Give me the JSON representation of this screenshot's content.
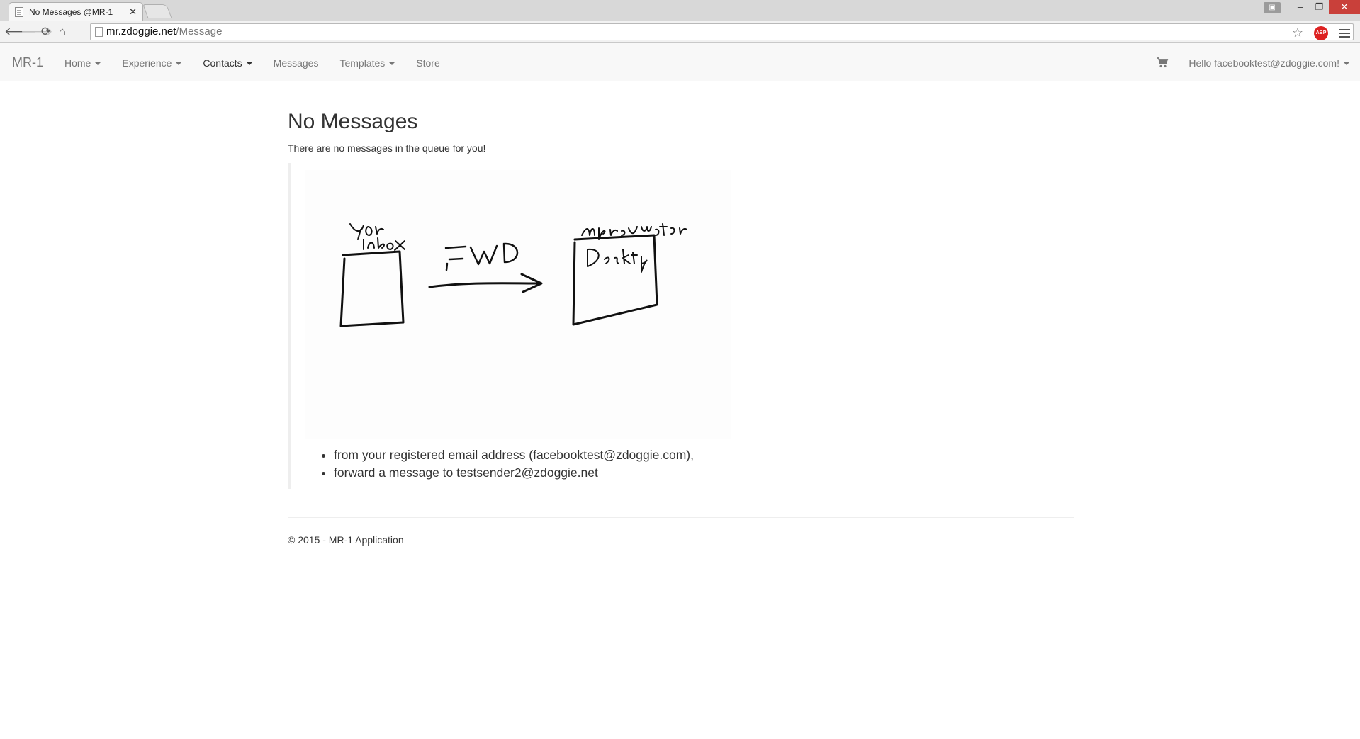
{
  "browser": {
    "tab_title": "No Messages @MR-1",
    "tab_close": "✕",
    "url_host": "mr.zdoggie.net",
    "url_path": "/Message"
  },
  "navbar": {
    "brand": "MR-1",
    "items": [
      {
        "label": "Home",
        "dropdown": true,
        "active": false
      },
      {
        "label": "Experience",
        "dropdown": true,
        "active": false
      },
      {
        "label": "Contacts",
        "dropdown": true,
        "active": true
      },
      {
        "label": "Messages",
        "dropdown": false,
        "active": false
      },
      {
        "label": "Templates",
        "dropdown": true,
        "active": false
      },
      {
        "label": "Store",
        "dropdown": false,
        "active": false
      }
    ],
    "cart_icon": "shopping-cart-icon",
    "user_greeting": "Hello facebooktest@zdoggie.com!"
  },
  "main": {
    "title": "No Messages",
    "lead": "There are no messages in the queue for you!",
    "steps": [
      "from your registered email address (facebooktest@zdoggie.com),",
      "forward a message to testsender2@zdoggie.net"
    ]
  },
  "footer": {
    "text": "© 2015 - MR-1 Application"
  }
}
